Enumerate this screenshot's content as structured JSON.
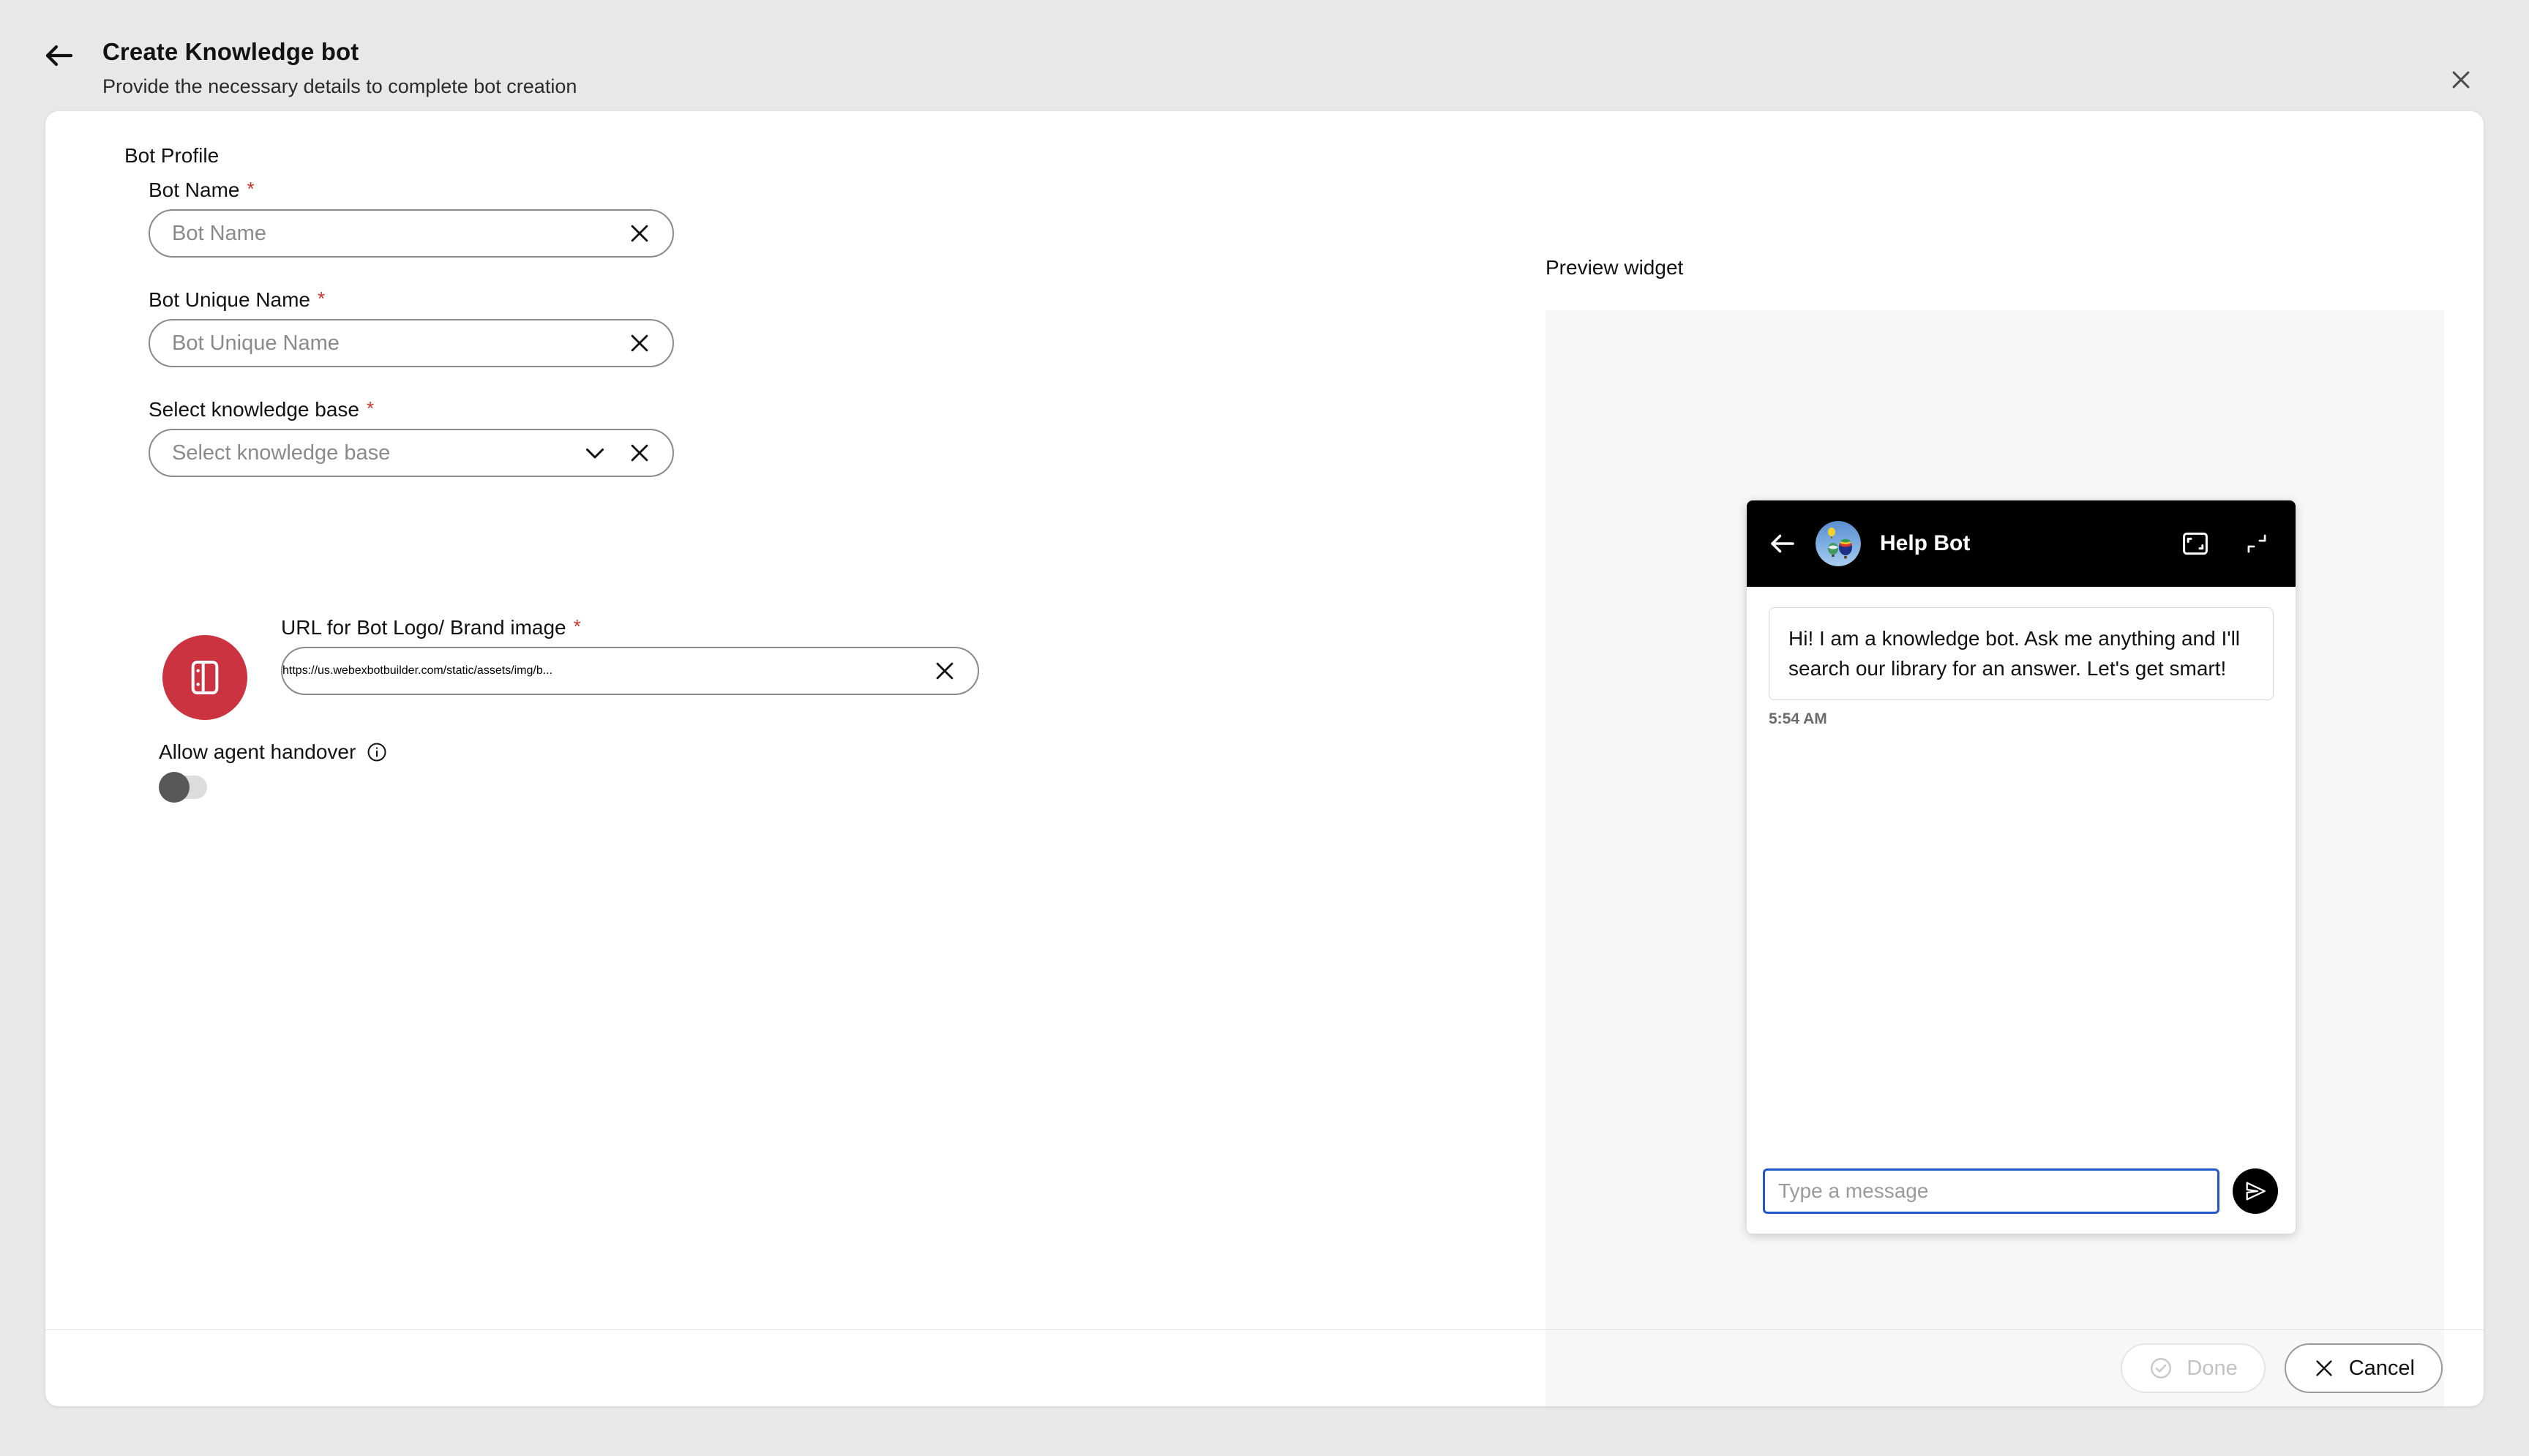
{
  "header": {
    "back_icon": "arrow-left-icon",
    "title": "Create Knowledge bot",
    "subtitle": "Provide the necessary details to complete bot creation",
    "close_icon": "close-icon"
  },
  "form": {
    "section_label": "Bot Profile",
    "fields": [
      {
        "label": "Bot Name",
        "required": "*",
        "placeholder": "Bot Name",
        "value": "",
        "clear_icon": "close-icon"
      },
      {
        "label": "Bot Unique Name",
        "required": "*",
        "placeholder": "Bot Unique Name",
        "value": "",
        "clear_icon": "close-icon"
      },
      {
        "label": "Select knowledge base",
        "required": "*",
        "placeholder": "Select knowledge base",
        "value": "",
        "chevron_icon": "chevron-down-icon",
        "clear_icon": "close-icon"
      }
    ],
    "logo": {
      "icon_name": "bot-card-logo-icon",
      "background_color": "#cc3340"
    },
    "url_field": {
      "label": "URL for Bot Logo/ Brand image",
      "required": "*",
      "value": "https://us.webexbotbuilder.com/static/assets/img/b...",
      "clear_icon": "close-icon"
    },
    "handover": {
      "label": "Allow agent handover",
      "info_icon": "info-icon",
      "toggle_state": "off"
    }
  },
  "preview": {
    "label": "Preview widget",
    "widget": {
      "back_icon": "arrow-left-icon",
      "avatar_icon": "hot-air-balloon-avatar",
      "title": "Help Bot",
      "expand_icon": "expand-icon",
      "minimize_icon": "minimize-icon",
      "message": "Hi! I am a knowledge bot. Ask me anything and I'll search our library for an answer. Let's get smart!",
      "timestamp": "5:54 AM",
      "input_placeholder": "Type a message",
      "send_icon": "send-icon",
      "accent_color": "#2058c8"
    }
  },
  "footer": {
    "done_label": "Done",
    "done_icon": "check-circle-icon",
    "done_enabled": "false",
    "cancel_label": "Cancel",
    "cancel_icon": "close-icon"
  }
}
